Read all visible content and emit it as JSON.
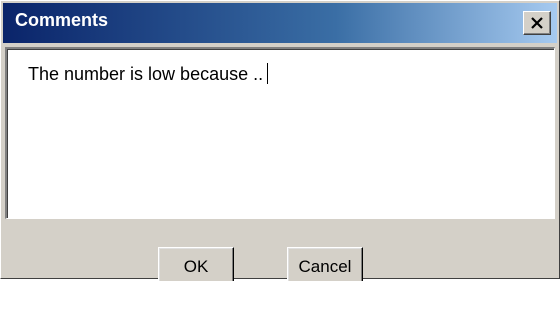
{
  "window": {
    "title": "Comments"
  },
  "titlebar": {
    "close_icon": "close-icon"
  },
  "comment_box": {
    "value": "The number is low because .."
  },
  "buttons": {
    "ok_label": "OK",
    "cancel_label": "Cancel"
  }
}
